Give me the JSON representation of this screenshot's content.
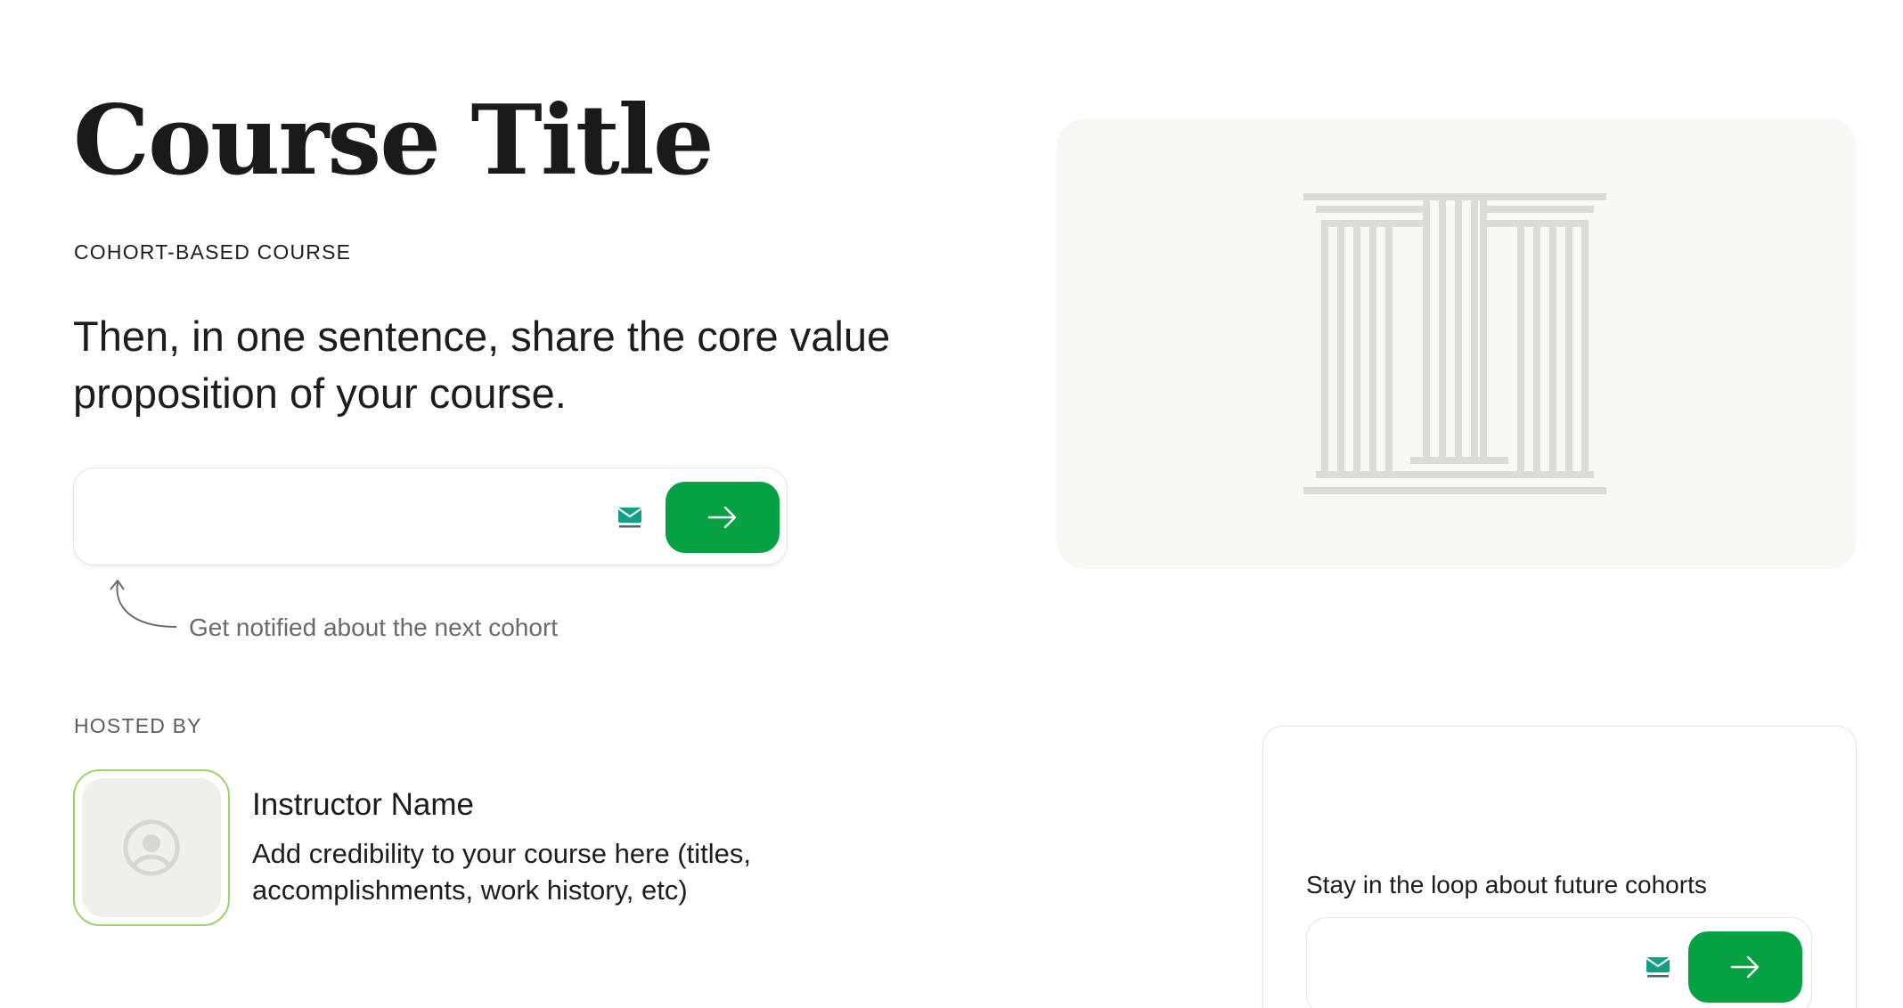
{
  "header": {
    "title": "Course Title",
    "course_type": "COHORT-BASED COURSE",
    "value_proposition": "Then, in one sentence, share the core value proposition of your course."
  },
  "signup": {
    "email_value": "",
    "email_placeholder": "",
    "mail_badge_icon": "tempmail-envelope-icon",
    "submit_icon": "arrow-right-icon",
    "hint": "Get notified about the next cohort",
    "hint_icon": "curved-arrow-up-icon"
  },
  "hero": {
    "image_icon": "pillars-logo-icon"
  },
  "host": {
    "section_label": "HOSTED BY",
    "avatar_icon": "user-placeholder-icon",
    "name": "Instructor Name",
    "bio": "Add credibility to your course here (titles, accomplishments, work history, etc)"
  },
  "loop": {
    "text": "Stay in the loop about future cohorts",
    "email_value": "",
    "email_placeholder": "",
    "submit_icon": "arrow-right-icon"
  },
  "colors": {
    "accent_green": "#06a143",
    "avatar_border": "#9fd06a",
    "hero_background": "#f7f7f4",
    "pillar_color": "#dcdcd6"
  }
}
